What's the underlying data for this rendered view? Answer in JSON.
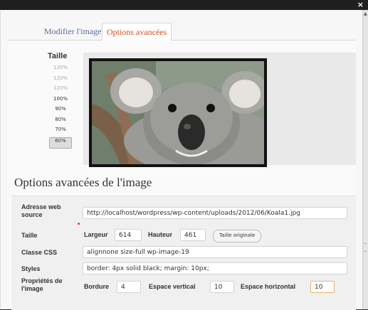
{
  "tabs": [
    {
      "label": "Modifier l'image"
    },
    {
      "label": "Options avancées"
    }
  ],
  "size_panel": {
    "label": "Taille",
    "options": [
      "120%",
      "120%",
      "120%",
      "100%",
      "90%",
      "80%",
      "70%",
      "60%"
    ],
    "selected": "60%"
  },
  "section_title": "Options avancées de l'image",
  "form": {
    "source": {
      "label": "Adresse web source",
      "value": "http://localhost/wordpress/wp-content/uploads/2012/06/Koala1.jpg"
    },
    "size": {
      "label": "Taille",
      "width_label": "Largeur",
      "width": "614",
      "height_label": "Hauteur",
      "height": "461",
      "original_button": "Taille originale"
    },
    "css_class": {
      "label": "Classe CSS",
      "value": "alignnone size-full wp-image-19"
    },
    "styles": {
      "label": "Styles",
      "value": "border: 4px solid black; margin: 10px;"
    },
    "props": {
      "label": "Propriétés de l'image",
      "border_label": "Bordure",
      "border": "4",
      "vspace_label": "Espace vertical",
      "vspace": "10",
      "hspace_label": "Espace horizontal",
      "hspace": "10"
    }
  },
  "window": {
    "close_glyph": "×"
  },
  "colors": {
    "accent": "#d54e21",
    "link": "#5d6e98",
    "focus_border": "#e8b26f"
  }
}
